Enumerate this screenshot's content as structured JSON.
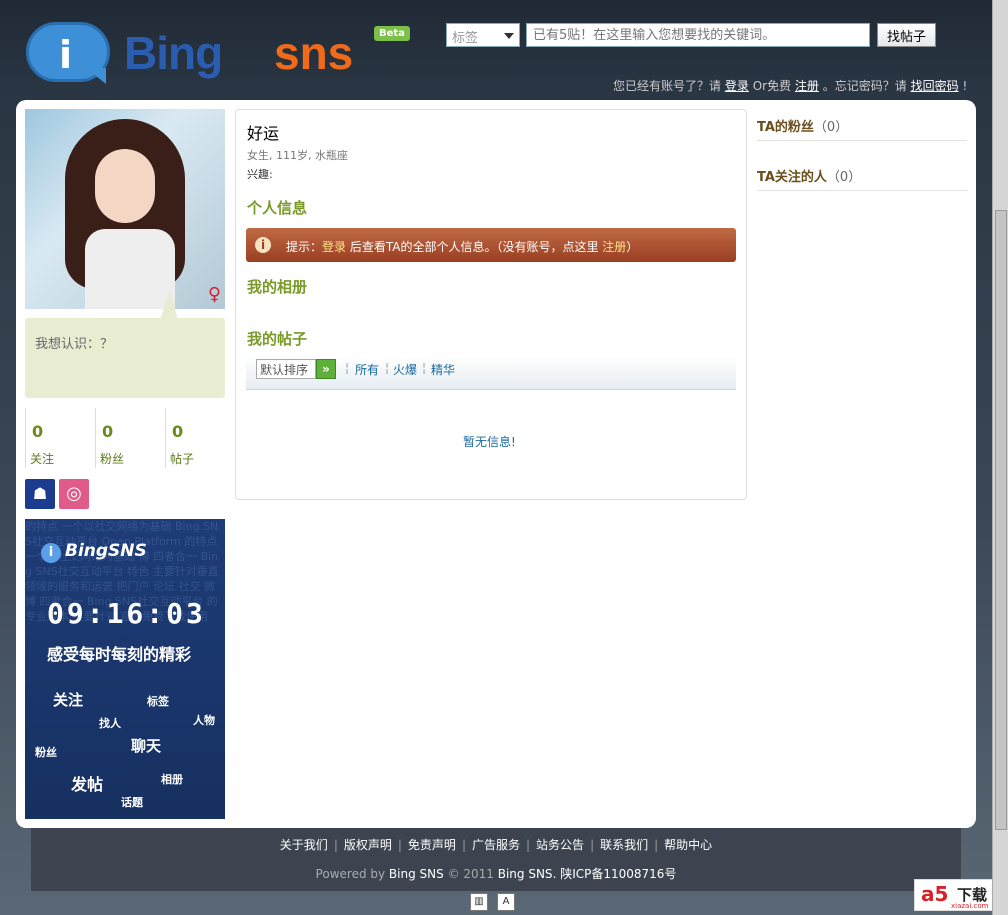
{
  "header": {
    "logo_main": "Bing",
    "logo_accent": "sns",
    "logo_badge": "Beta",
    "search": {
      "select_value": "标签",
      "input_placeholder": "已有5贴！在这里输入您想要找的关键词。",
      "button_label": "找帖子"
    },
    "login_bar": {
      "prefix": "您已经有账号了？请",
      "login": "登录",
      "middle": "Or免费",
      "register": "注册",
      "forgot_prefix": "。忘记密码？请",
      "forgot": "找回密码",
      "suffix": "!"
    }
  },
  "profile": {
    "want_to_know": "我想认识：？",
    "gender_icon": "female-symbol-icon",
    "stats": [
      {
        "value": "0",
        "label": "关注"
      },
      {
        "value": "0",
        "label": "粉丝"
      },
      {
        "value": "0",
        "label": "帖子"
      }
    ],
    "social": [
      "msn-icon",
      "dribbble-icon"
    ]
  },
  "banner": {
    "logo": "BingSNS",
    "clock": "09:16:03",
    "slogan": "感受每时每刻的精彩",
    "words": [
      "关注",
      "标签",
      "找人",
      "人物",
      "粉丝",
      "聊天",
      "发帖",
      "相册",
      "话题"
    ],
    "bg_text": "的特点 一个以社交网络为基础 Bing SNS社交互动平台 Open Platform 的特点 一个以社交网络为基础 博 四者合一 Bing SNS社交互动平台 特色 主要针对垂直领域的服务和运营 把门户 论坛 社交 微博 四者合一 Bing SNS社交互动平台 的专业版本 主要针对 官方免费下载使用"
  },
  "user": {
    "name": "好运",
    "meta": "女生, 111岁, 水瓶座",
    "interest": "兴趣:"
  },
  "sections": {
    "personal_info": "个人信息",
    "album": "我的相册",
    "posts": "我的帖子"
  },
  "tip": {
    "prefix": "提示：",
    "login": "登录",
    "middle": " 后查看TA的全部个人信息。（没有账号，点这里 ",
    "register": "注册",
    "suffix": "）"
  },
  "posts_bar": {
    "sort_value": "默认排序",
    "go_icon": "double-arrow-icon",
    "filters": [
      "所有",
      "火爆",
      "精华"
    ]
  },
  "no_info": "暂无信息!",
  "right": {
    "fans_title": "TA的粉丝",
    "fans_count": "（0）",
    "following_title": "TA关注的人",
    "following_count": "（0）"
  },
  "footer": {
    "links": [
      "关于我们",
      "版权声明",
      "免责声明",
      "广告服务",
      "站务公告",
      "联系我们",
      "帮助中心"
    ],
    "powered_prefix": "Powered by ",
    "powered_brand": "Bing SNS",
    "copyright": " © 2011 ",
    "copyright_brand": "Bing SNS",
    "icp": ". 陕ICP备11008716号"
  },
  "watermark": {
    "mark": "a5",
    "text": "下载",
    "sub": "xiazai.com"
  }
}
